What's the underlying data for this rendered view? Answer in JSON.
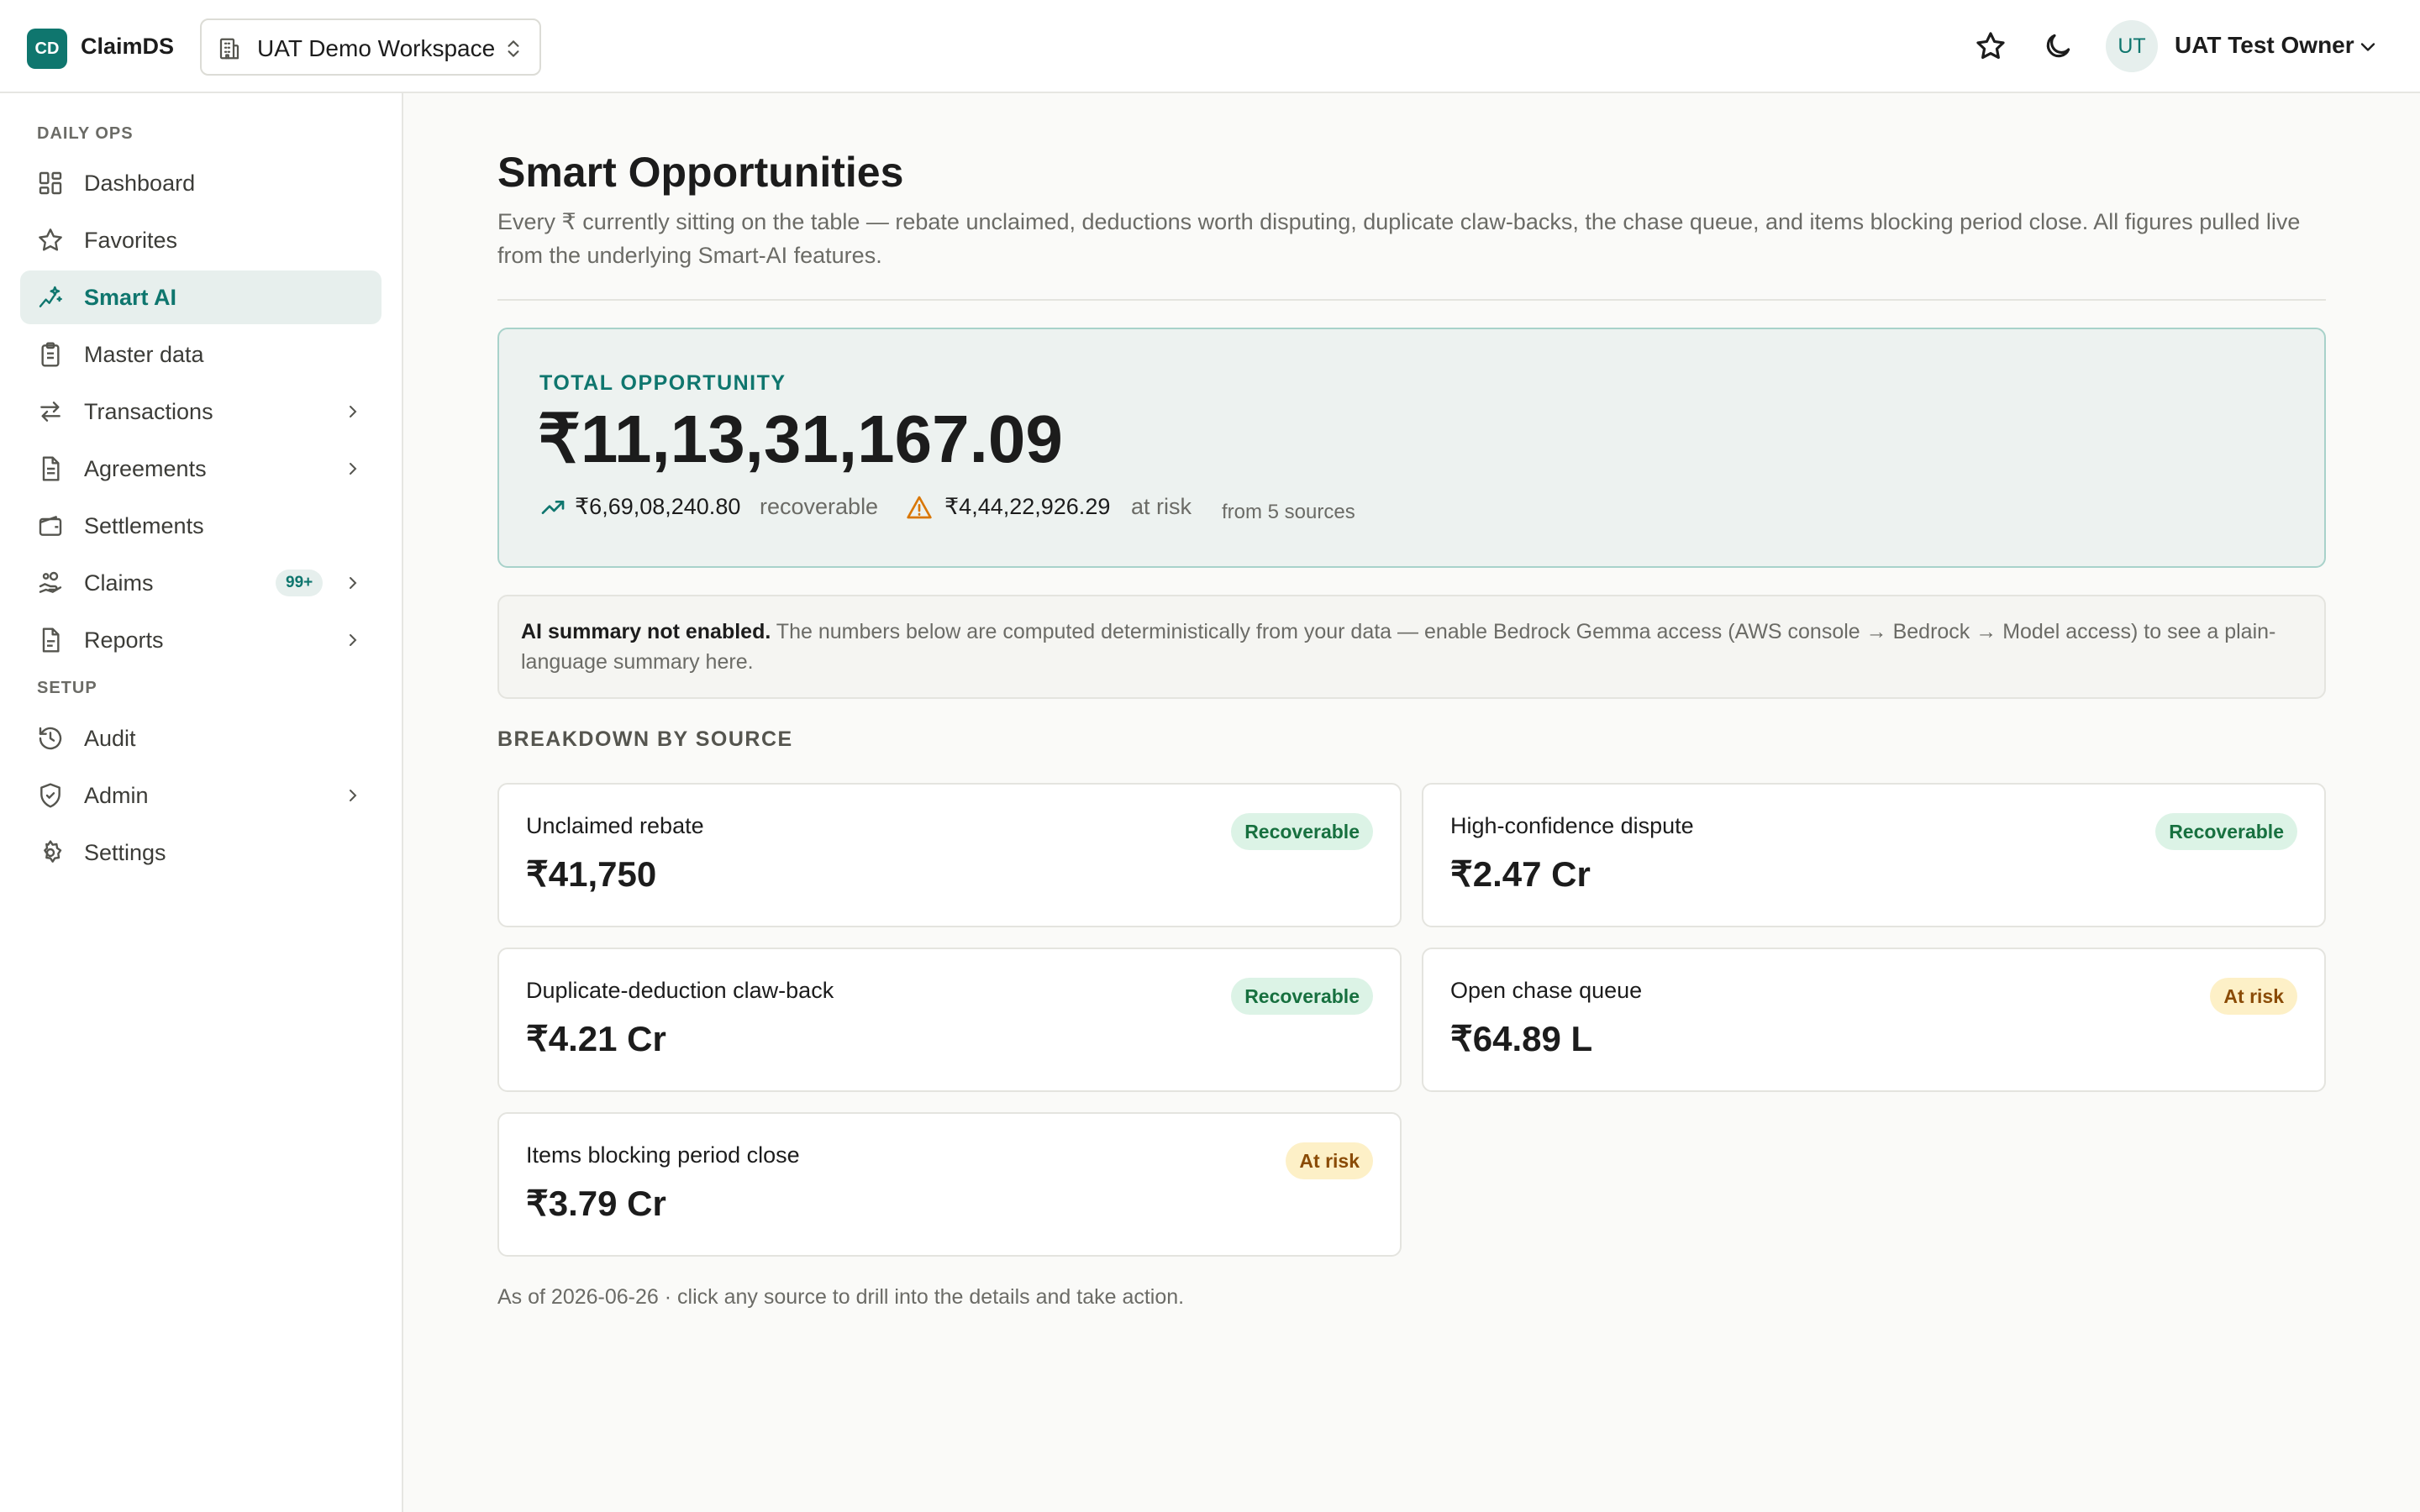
{
  "app": {
    "logo_text": "CD",
    "brand": "ClaimDS",
    "workspace": "UAT Demo Workspace",
    "user_initials": "UT",
    "user_name": "UAT Test Owner"
  },
  "sidebar": {
    "section_daily": "DAILY OPS",
    "section_setup": "SETUP",
    "items": [
      {
        "label": "Dashboard",
        "icon": "dashboard-icon"
      },
      {
        "label": "Favorites",
        "icon": "star-icon"
      },
      {
        "label": "Smart AI",
        "icon": "sparkles-icon",
        "active": true
      },
      {
        "label": "Master data",
        "icon": "clipboard-icon"
      },
      {
        "label": "Transactions",
        "icon": "arrows-icon",
        "chevron": true
      },
      {
        "label": "Agreements",
        "icon": "document-icon",
        "chevron": true
      },
      {
        "label": "Settlements",
        "icon": "wallet-icon"
      },
      {
        "label": "Claims",
        "icon": "hand-coins-icon",
        "chevron": true,
        "badge": "99+"
      },
      {
        "label": "Reports",
        "icon": "report-icon",
        "chevron": true
      },
      {
        "label": "Audit",
        "icon": "history-icon"
      },
      {
        "label": "Admin",
        "icon": "shield-icon",
        "chevron": true
      },
      {
        "label": "Settings",
        "icon": "gear-icon"
      }
    ]
  },
  "page": {
    "title": "Smart Opportunities",
    "description": "Every ₹ currently sitting on the table — rebate unclaimed, deductions worth disputing, duplicate claw-backs, the chase queue, and items blocking period close. All figures pulled live from the underlying Smart-AI features."
  },
  "total": {
    "label": "TOTAL OPPORTUNITY",
    "value": "₹11,13,31,167.09",
    "recoverable_amount": "₹6,69,08,240.80",
    "recoverable_text": "recoverable",
    "at_risk_amount": "₹4,44,22,926.29",
    "at_risk_text": "at risk",
    "sources_text": "from 5 sources"
  },
  "ai_note": {
    "title": "AI summary not enabled.",
    "text": "The numbers below are computed deterministically from your data — enable Bedrock Gemma access (AWS console → Bedrock → Model access) to see a plain-language summary here."
  },
  "breakdown": {
    "label": "BREAKDOWN BY SOURCE",
    "sources": [
      {
        "name": "Unclaimed rebate",
        "value": "₹41,750",
        "status": "Recoverable"
      },
      {
        "name": "High-confidence dispute",
        "value": "₹2.47 Cr",
        "status": "Recoverable"
      },
      {
        "name": "Duplicate-deduction claw-back",
        "value": "₹4.21 Cr",
        "status": "Recoverable"
      },
      {
        "name": "Open chase queue",
        "value": "₹64.89 L",
        "status": "At risk"
      },
      {
        "name": "Items blocking period close",
        "value": "₹3.79 Cr",
        "status": "At risk"
      }
    ]
  },
  "footnote": "As of 2026-06-26 · click any source to drill into the details and take action.",
  "colors": {
    "accent": "#0f766e",
    "recoverable_bg": "#dcf3e6",
    "recoverable_text": "#17703f",
    "at_risk_bg": "#fdf0c7",
    "at_risk_text": "#8a4b06",
    "warning_icon": "#d97706"
  }
}
